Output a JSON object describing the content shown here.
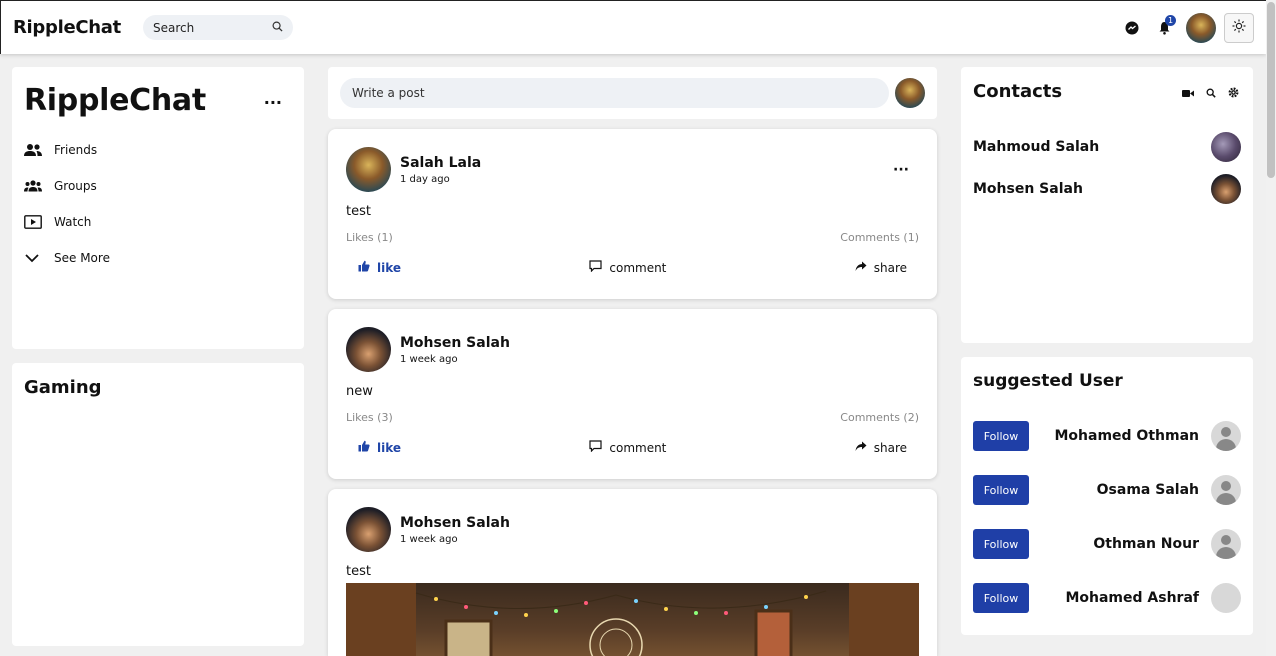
{
  "app": {
    "brand": "RippleChat"
  },
  "topbar": {
    "search_label": "Search",
    "notification_count": "1",
    "icons": [
      "messenger-icon",
      "bell-icon",
      "sun-icon"
    ]
  },
  "leftnav": {
    "title": "RippleChat",
    "more": "...",
    "items": [
      {
        "label": "Friends",
        "icon": "friends-icon"
      },
      {
        "label": "Groups",
        "icon": "groups-icon"
      },
      {
        "label": "Watch",
        "icon": "watch-icon"
      },
      {
        "label": "See More",
        "icon": "chevron-down-icon"
      }
    ]
  },
  "gaming": {
    "title": "Gaming"
  },
  "composer": {
    "placeholder": "Write a post"
  },
  "posts": [
    {
      "author": "Salah Lala",
      "time": "1 day ago",
      "text": "test",
      "likes": "Likes (1)",
      "comments": "Comments (1)",
      "like_label": "like",
      "comment_label": "comment",
      "share_label": "share"
    },
    {
      "author": "Mohsen Salah",
      "time": "1 week ago",
      "text": "new",
      "likes": "Likes (3)",
      "comments": "Comments (2)",
      "like_label": "like",
      "comment_label": "comment",
      "share_label": "share"
    },
    {
      "author": "Mohsen Salah",
      "time": "1 week ago",
      "text": "test"
    }
  ],
  "contacts": {
    "title": "Contacts",
    "items": [
      {
        "name": "Mahmoud Salah"
      },
      {
        "name": "Mohsen Salah"
      }
    ]
  },
  "suggested": {
    "title": "suggested User",
    "follow_label": "Follow",
    "items": [
      {
        "name": "Mohamed Othman"
      },
      {
        "name": "Osama Salah"
      },
      {
        "name": "Othman Nour"
      },
      {
        "name": "Mohamed Ashraf"
      }
    ]
  },
  "colors": {
    "accent": "#1f3fa7",
    "background": "#f0f0f0"
  }
}
